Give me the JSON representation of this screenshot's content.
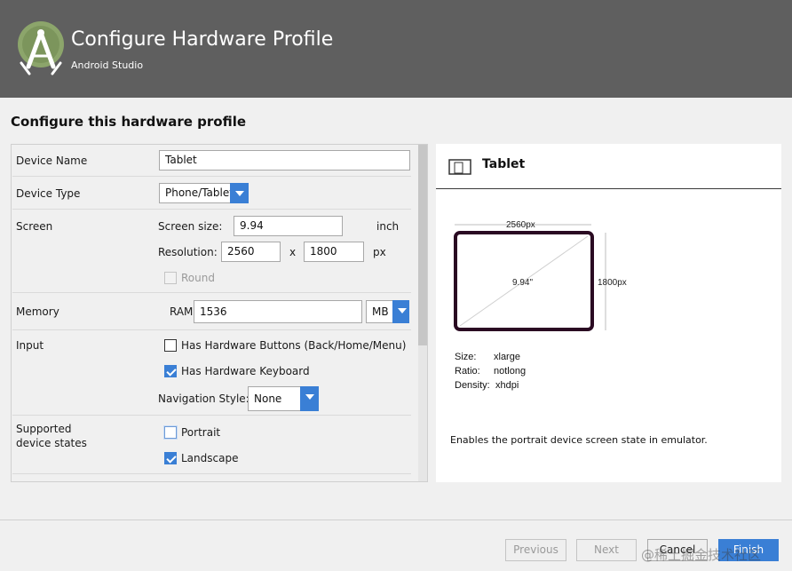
{
  "window": {
    "title": "Configure Hardware Profile",
    "subtitle": "Android Studio"
  },
  "section_title": "Configure this hardware profile",
  "form": {
    "device_name": {
      "label": "Device Name",
      "value": "Tablet"
    },
    "device_type": {
      "label": "Device Type",
      "value": "Phone/Tablet"
    },
    "screen": {
      "label": "Screen",
      "size_label": "Screen size:",
      "size_value": "9.94",
      "size_unit": "inch",
      "resolution_label": "Resolution:",
      "res_width": "2560",
      "res_sep": "x",
      "res_height": "1800",
      "res_unit": "px",
      "round_label": "Round",
      "round_checked": false
    },
    "memory": {
      "label": "Memory",
      "ram_label": "RAM:",
      "ram_value": "1536",
      "ram_unit": "MB"
    },
    "input": {
      "label": "Input",
      "hw_buttons_label": "Has Hardware Buttons (Back/Home/Menu)",
      "hw_buttons_checked": false,
      "hw_keyboard_label": "Has Hardware Keyboard",
      "hw_keyboard_checked": true,
      "nav_style_label": "Navigation Style:",
      "nav_style_value": "None"
    },
    "states": {
      "label": "Supported device states",
      "portrait_label": "Portrait",
      "portrait_checked": false,
      "landscape_label": "Landscape",
      "landscape_checked": true
    }
  },
  "preview": {
    "title": "Tablet",
    "width_label": "2560px",
    "height_label": "1800px",
    "diagonal_label": "9.94\"",
    "size_key": "Size:",
    "size_value": "xlarge",
    "ratio_key": "Ratio:",
    "ratio_value": "notlong",
    "density_key": "Density:",
    "density_value": "xhdpi",
    "description": "Enables the portrait device screen state in emulator."
  },
  "buttons": {
    "previous": "Previous",
    "next": "Next",
    "cancel": "Cancel",
    "finish": "Finish"
  },
  "watermark": "@稀土掘金技术社区",
  "colors": {
    "header_bg": "#5f5f5f",
    "accent": "#3a7fd5",
    "logo_green": "#8ca56b"
  },
  "icons": {
    "logo": "android-studio-logo",
    "preview": "tablet-icon",
    "dropdown": "chevron-down-icon"
  }
}
